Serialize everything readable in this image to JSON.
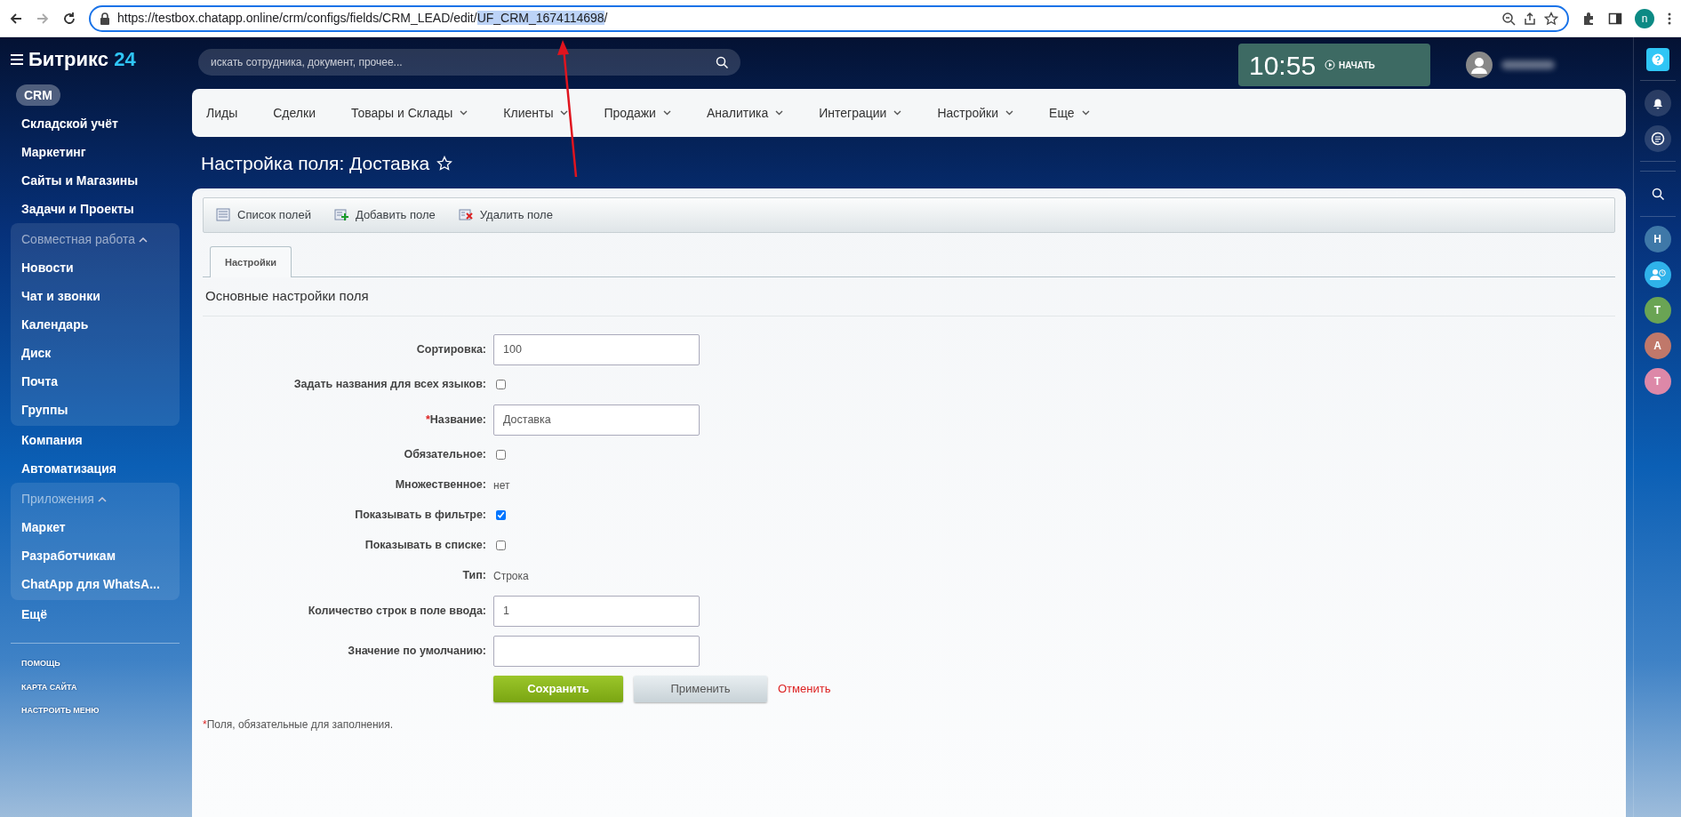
{
  "browser": {
    "url_parts": [
      {
        "text": "https://testbox.chatapp.online/crm/configs/fields/CRM_LEAD/edit/",
        "selected": false
      },
      {
        "text": "UF_CRM_1674114698",
        "selected": true
      },
      {
        "text": "/",
        "selected": false
      }
    ],
    "profile_initial": "n"
  },
  "sidebar": {
    "logo": {
      "name": "Битрикс",
      "number": "24"
    },
    "items": [
      {
        "kind": "item",
        "label": "CRM",
        "selected": true
      },
      {
        "kind": "item",
        "label": "Складской учёт",
        "selected": false
      },
      {
        "kind": "item",
        "label": "Маркетинг",
        "selected": false
      },
      {
        "kind": "item",
        "label": "Сайты и Магазины",
        "selected": false
      },
      {
        "kind": "item",
        "label": "Задачи и Проекты",
        "selected": false
      },
      {
        "kind": "group",
        "label": "Совместная работа",
        "expanded": true,
        "children": [
          {
            "label": "Новости",
            "selected": false
          },
          {
            "label": "Чат и звонки",
            "selected": false
          },
          {
            "label": "Календарь",
            "selected": false
          },
          {
            "label": "Диск",
            "selected": false
          },
          {
            "label": "Почта",
            "selected": false
          },
          {
            "label": "Группы",
            "selected": false
          }
        ]
      },
      {
        "kind": "item",
        "label": "Компания",
        "selected": false
      },
      {
        "kind": "item",
        "label": "Автоматизация",
        "selected": false
      },
      {
        "kind": "group",
        "label": "Приложения",
        "expanded": true,
        "children": [
          {
            "label": "Маркет",
            "selected": false
          },
          {
            "label": "Разработчикам",
            "selected": false
          },
          {
            "label": "ChatApp для WhatsA...",
            "selected": false
          }
        ]
      },
      {
        "kind": "more",
        "label": "Ещё",
        "selected": false
      }
    ],
    "footer_links": [
      "ПОМОЩЬ",
      "КАРТА САЙТА",
      "НАСТРОИТЬ МЕНЮ"
    ]
  },
  "topbar": {
    "search": {
      "placeholder": "искать сотрудника, документ, прочее..."
    },
    "clock": {
      "time": "10:55",
      "start_label": "НАЧАТЬ"
    }
  },
  "nav": [
    {
      "label": "Лиды",
      "has_menu": false
    },
    {
      "label": "Сделки",
      "has_menu": false
    },
    {
      "label": "Товары и Склады",
      "has_menu": true
    },
    {
      "label": "Клиенты",
      "has_menu": true
    },
    {
      "label": "Продажи",
      "has_menu": true
    },
    {
      "label": "Аналитика",
      "has_menu": true
    },
    {
      "label": "Интеграции",
      "has_menu": true
    },
    {
      "label": "Настройки",
      "has_menu": true
    },
    {
      "label": "Еще",
      "has_menu": true
    }
  ],
  "page_title": "Настройка поля: Доставка",
  "toolbar": [
    {
      "kind": "list",
      "label": "Список полей"
    },
    {
      "kind": "add",
      "label": "Добавить поле"
    },
    {
      "kind": "delete",
      "label": "Удалить поле"
    }
  ],
  "tabs": [
    {
      "label": "Настройки",
      "selected": true
    }
  ],
  "section_title": "Основные настройки поля",
  "fields": [
    {
      "kind": "input",
      "label": "Сортировка:",
      "value": "100"
    },
    {
      "kind": "checkbox",
      "label": "Задать названия для всех языков:",
      "checked": false
    },
    {
      "kind": "input",
      "label": "Название:",
      "required_mark": "*",
      "value": "Доставка"
    },
    {
      "kind": "checkbox",
      "label": "Обязательное:",
      "checked": false
    },
    {
      "kind": "text",
      "label": "Множественное:",
      "value": "нет"
    },
    {
      "kind": "checkbox",
      "label": "Показывать в фильтре:",
      "checked": true
    },
    {
      "kind": "checkbox",
      "label": "Показывать в списке:",
      "checked": false
    },
    {
      "kind": "text",
      "label": "Тип:",
      "value": "Строка"
    },
    {
      "kind": "input",
      "label": "Количество строк в поле ввода:",
      "value": "1"
    },
    {
      "kind": "input",
      "label": "Значение по умолчанию:"
    }
  ],
  "buttons": [
    {
      "kind": "save",
      "label": "Сохранить"
    },
    {
      "kind": "apply",
      "label": "Применить"
    },
    {
      "kind": "cancel",
      "label": "Отменить"
    }
  ],
  "footnote": {
    "mark": "*",
    "text": "Поля, обязательные для заполнения."
  },
  "right_panel": [
    {
      "kind": "help"
    },
    {
      "kind": "bell"
    },
    {
      "kind": "chat"
    },
    {
      "kind": "search"
    },
    {
      "kind": "letter",
      "letter": "Н",
      "color": "#3f78a8"
    },
    {
      "kind": "user-clock",
      "color": "#2fb2ea"
    },
    {
      "kind": "letter",
      "letter": "Т",
      "color": "#6aa454"
    },
    {
      "kind": "letter",
      "letter": "А",
      "color": "#c0786a"
    },
    {
      "kind": "letter",
      "letter": "Т",
      "color": "#dd88a8"
    }
  ]
}
